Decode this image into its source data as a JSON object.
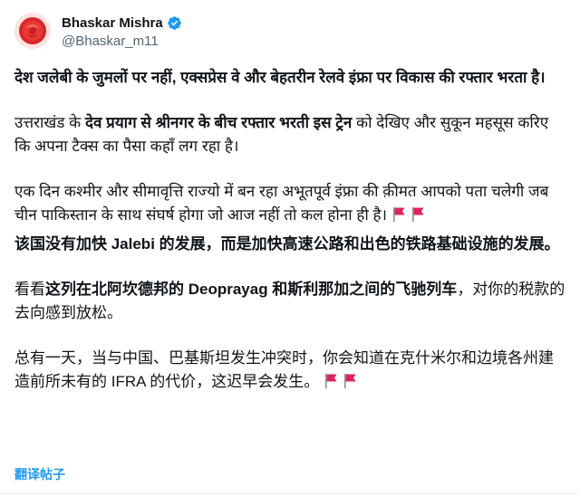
{
  "author": {
    "display_name": "Bhaskar Mishra",
    "handle": "@Bhaskar_m11",
    "verified_icon": "verified-badge-icon",
    "badge_color": "#1d9bf0"
  },
  "tweet": {
    "p1": "देश जलेबी के जुमलों पर नहीं, एक्सप्रेस वे और बेहतरीन रेलवे इंफ्रा पर विकास की रफ्तार भरता है।",
    "p2_before": "उत्तराखंड के ",
    "p2_bold": "देव प्रयाग से श्रीनगर के बीच रफ्तार भरती इस ट्रेन",
    "p2_after": " को देखिए और सुकून महसूस करिए कि अपना टैक्स का पैसा कहाँ लग रहा है।",
    "p3": "एक दिन कश्मीर और सीमावृत्ति राज्यो में बन रहा अभूतपूर्व इंफ्रा की क़ीमत आपको पता चलेगी जब चीन पाकिस्तान के साथ संघर्ष होगा जो आज नहीं तो कल होना ही है।",
    "p4": "该国没有加快 Jalebi 的发展，而是加快高速公路和出色的铁路基础设施的发展。",
    "p5_before": "看看",
    "p5_bold": "这列在北阿坎德邦的 Deoprayag 和斯利那加之间的飞驰列车",
    "p5_after": "，对你的税款的去向感到放松。",
    "p6": "总有一天，当与中国、巴基斯坦发生冲突时，你会知道在克什米尔和边境各州建造前所未有的 IFRA 的代价，这迟早会发生。",
    "flag_icon": "red-flag-icon",
    "flag_color": "#e0245e"
  },
  "translate_link": "翻译帖子",
  "colors": {
    "text": "#0f1419",
    "secondary": "#536471",
    "link": "#1d9bf0"
  }
}
